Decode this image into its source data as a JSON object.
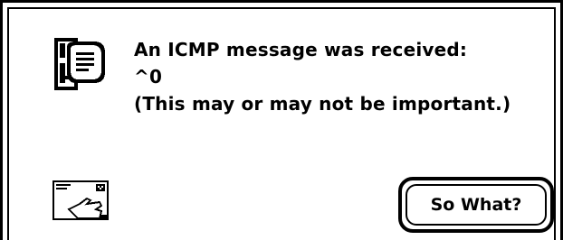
{
  "dialog": {
    "icon": "stop-alert-speech-icon",
    "message_lines": [
      "An ICMP message was received:",
      "^0",
      "(This may or may not be important.)"
    ],
    "sender_icon": "envelope-hand-icon",
    "button_label": "So What?"
  }
}
